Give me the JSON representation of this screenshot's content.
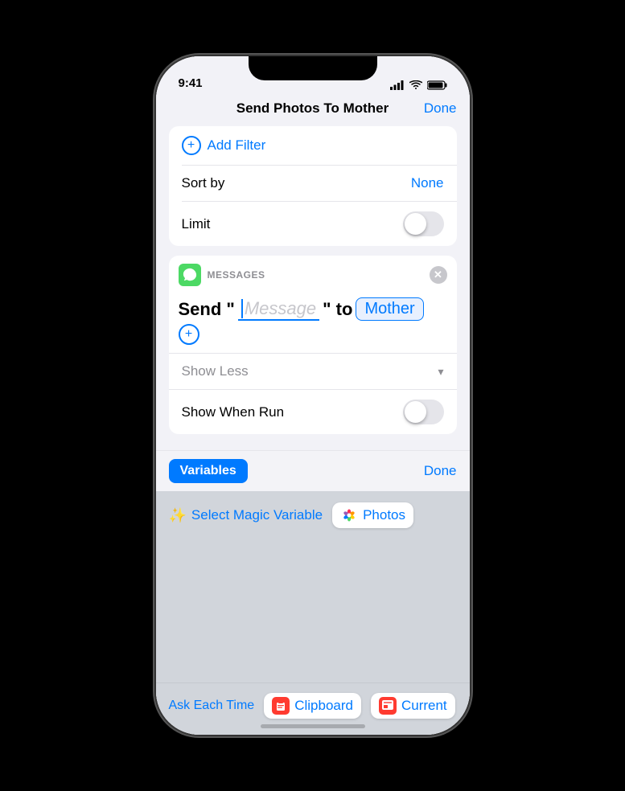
{
  "status_bar": {
    "time": "9:41",
    "signal_icon": "signal-icon",
    "wifi_icon": "wifi-icon",
    "battery_icon": "battery-icon"
  },
  "nav": {
    "title": "Send Photos To Mother",
    "done_label": "Done"
  },
  "filter_section": {
    "add_filter_label": "Add Filter",
    "sort_row": {
      "label": "Sort by",
      "value": "None"
    },
    "limit_row": {
      "label": "Limit",
      "toggle_state": false
    }
  },
  "messages_card": {
    "app_label": "MESSAGES",
    "send_prefix": "Send \"",
    "message_placeholder": "Message",
    "send_suffix": "\" to",
    "recipient": "Mother",
    "show_less_label": "Show Less",
    "show_when_run_label": "Show When Run",
    "show_when_run_toggle": false
  },
  "variables_bar": {
    "button_label": "Variables",
    "done_label": "Done"
  },
  "variable_options": {
    "magic_label": "Select Magic Variable",
    "photos_label": "Photos"
  },
  "bottom_chips": {
    "ask_each_time": "Ask Each Time",
    "clipboard": "Clipboard",
    "current": "Current"
  }
}
